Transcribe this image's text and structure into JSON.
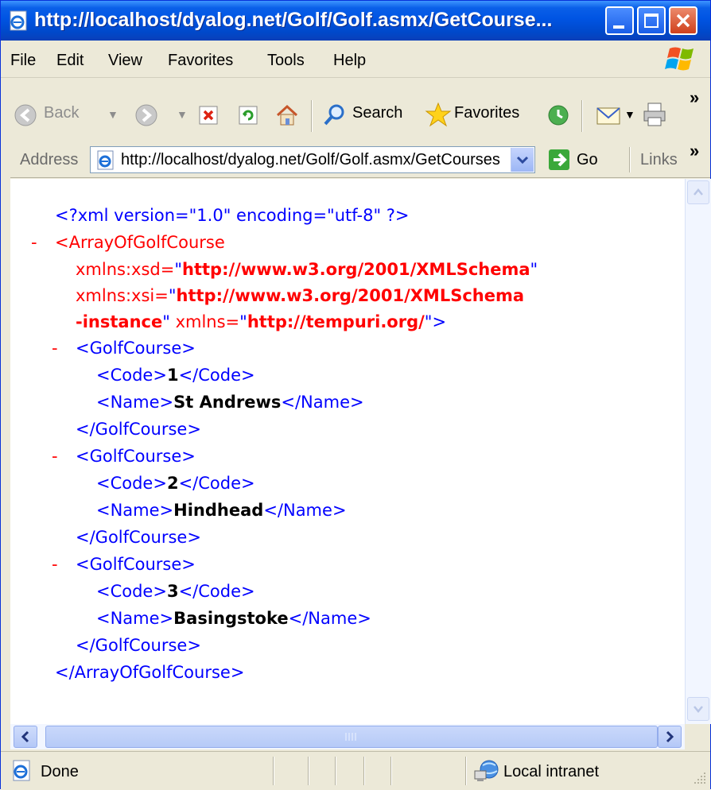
{
  "window": {
    "title": "http://localhost/dyalog.net/Golf/Golf.asmx/GetCourse..."
  },
  "menu": [
    "File",
    "Edit",
    "View",
    "Favorites",
    "Tools",
    "Help"
  ],
  "toolbar": {
    "back_label": "Back",
    "search_label": "Search",
    "favorites_label": "Favorites",
    "more": "»"
  },
  "address": {
    "label": "Address",
    "value": "http://localhost/dyalog.net/Golf/Golf.asmx/GetCourses",
    "go_label": "Go",
    "links_label": "Links",
    "more": "»"
  },
  "xml": {
    "decl": "<?xml version=\"1.0\" encoding=\"utf-8\" ?>",
    "minus": "-",
    "root_open": "<ArrayOfGolfCourse",
    "xsd_attr": "xmlns:xsd=",
    "xsd_val": "http://www.w3.org/2001/XMLSchema",
    "xsi_attr": "xmlns:xsi=",
    "xsi_val_1": "http://www.w3.org/2001/XMLSchema",
    "xsi_val_2": "-instance",
    "xmlns_attr": "xmlns=",
    "xmlns_val": "http://tempuri.org/",
    "quote": "\"",
    "close_bracket": ">",
    "course_open": "<GolfCourse>",
    "course_close": "</GolfCourse>",
    "code_open": "<Code>",
    "code_close": "</Code>",
    "name_open": "<Name>",
    "name_close": "</Name>",
    "root_close": "</ArrayOfGolfCourse>",
    "courses": [
      {
        "code": "1",
        "name": "St Andrews"
      },
      {
        "code": "2",
        "name": "Hindhead"
      },
      {
        "code": "3",
        "name": "Basingstoke"
      }
    ]
  },
  "status": {
    "text": "Done",
    "zone": "Local intranet"
  }
}
